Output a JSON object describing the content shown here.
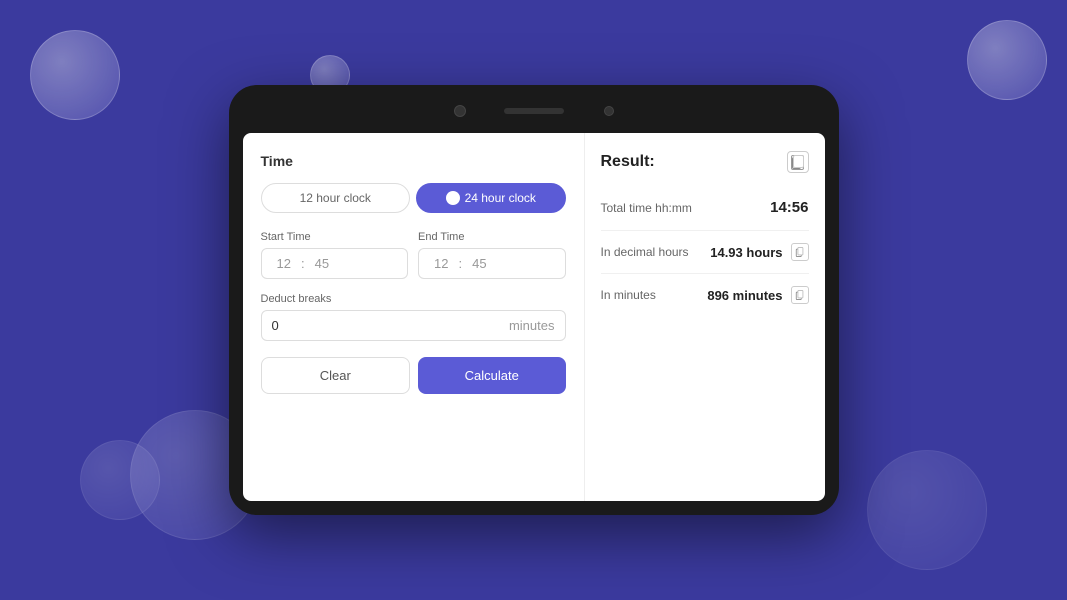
{
  "background": {
    "color": "#3b3a9e"
  },
  "bubbles": [
    {
      "class": "bubble-1"
    },
    {
      "class": "bubble-2"
    },
    {
      "class": "bubble-3"
    },
    {
      "class": "bubble-4"
    },
    {
      "class": "bubble-5"
    },
    {
      "class": "bubble-6"
    }
  ],
  "tablet": {
    "left_panel": {
      "title": "Time",
      "clock_options": [
        {
          "label": "12 hour clock",
          "active": false
        },
        {
          "label": "24 hour clock",
          "active": true
        }
      ],
      "start_time": {
        "label": "Start Time",
        "hours": "12",
        "separator": ":",
        "minutes": "45"
      },
      "end_time": {
        "label": "End Time",
        "hours": "12",
        "separator": ":",
        "minutes": "45"
      },
      "deduct_breaks": {
        "label": "Deduct breaks",
        "value": "0",
        "unit": "minutes"
      },
      "buttons": {
        "clear": "Clear",
        "calculate": "Calculate"
      }
    },
    "right_panel": {
      "title": "Result:",
      "rows": [
        {
          "label": "Total time hh:mm",
          "value": "14:56",
          "show_copy": false
        },
        {
          "label": "In decimal hours",
          "value": "14.93 hours",
          "show_copy": true
        },
        {
          "label": "In minutes",
          "value": "896 minutes",
          "show_copy": true
        }
      ]
    }
  }
}
